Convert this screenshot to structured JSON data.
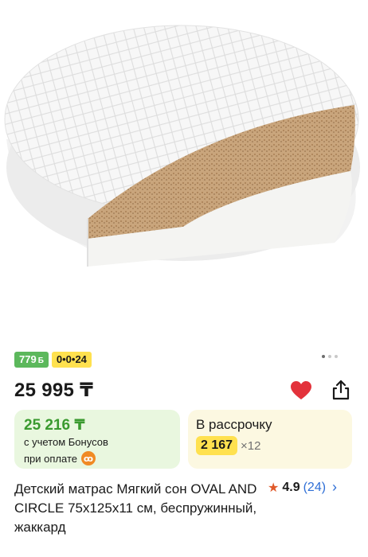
{
  "product": {
    "image_alt": "round baby mattress",
    "cashback_badge": "779",
    "cashback_symbol": "Б",
    "installment_badge": "0•0•24",
    "gallery_dots": 3,
    "gallery_active_index": 0,
    "price": "25 995 ₸",
    "favorite_active": true,
    "title": "Детский матрас Мягкий сон OVAL AND CIRCLE 75x125x11 см, беспружинный, жаккард",
    "rating": "4.9",
    "reviews": "(24)"
  },
  "bonus_card": {
    "price": "25 216 ₸",
    "line1": "с учетом Бонусов",
    "line2": "при оплате",
    "icon": "payment-brand-icon"
  },
  "installment_card": {
    "title": "В рассрочку",
    "amount": "2 167",
    "multiplier": "×12"
  },
  "colors": {
    "accent_red": "#e3323b",
    "bonus_green": "#3a9a2f",
    "badge_green": "#5cb85c",
    "badge_yellow": "#ffe14f",
    "link_blue": "#2f6fd6"
  }
}
